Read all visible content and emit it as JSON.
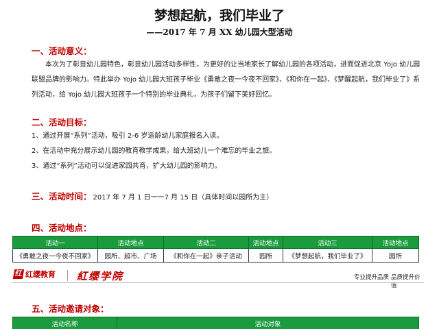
{
  "doc": {
    "title": "梦想起航，我们毕业了",
    "subtitle": "——2017 年 7 月 XX 幼儿园大型活动"
  },
  "sections": {
    "s1": {
      "heading": "一、活动意义：",
      "paragraph": "本次为了彰显幼儿园特色，彰显幼儿园活动多样性，为更好的让当地家长了解幼儿园的各项活动，进而促进北京 Yojo 幼儿园联盟品牌的影响力。特此举办 Yojo 幼儿园大班孩子毕业《勇敢之夜一今夜不回家》、《和你在一起》、《梦醒起航，我们毕业了》系列活动，给 Yojo 幼儿园大班孩子一个特别的毕业典礼，为孩子们留下美好回忆。"
    },
    "s2": {
      "heading": "二、活动目标：",
      "items": [
        "1、通过开展“系列”活动，吸引 2-6 岁适龄幼儿家庭报名入读。",
        "2、在活动中充分展示幼儿园的教育教学成果，给大班幼儿一个难忘的毕业之旅。",
        "3、通过“系列”活动可以促进家园共育，扩大幼儿园的影响力。"
      ]
    },
    "s3": {
      "heading": "三、活动时间：",
      "text": "2017 年 7 月 1 日一一7 月 15 日（具体时间以园所为主）"
    },
    "s4": {
      "heading": "四、活动地点：",
      "headers": [
        "活动一",
        "活动地点",
        "活动二",
        "活动地点",
        "活动三",
        "活动地点"
      ],
      "row": [
        "《勇敢之夜一今夜不回家》",
        "园所、超市、广场",
        "《和你在一起》亲子活动",
        "园所",
        "《梦想起航，我们毕业了》",
        "园所"
      ]
    },
    "s5": {
      "heading": "五、活动邀请对象：",
      "headers": [
        "活动名称",
        "活动对象"
      ]
    }
  },
  "banner": {
    "logo_mark": "红",
    "logo_a": "红缨教育",
    "logo_b": "紅缨学院",
    "slogan1": "专业提升品质",
    "slogan2": "品质提升价值"
  },
  "colors": {
    "heading": "#c00000",
    "table_header": "#1a9b3d"
  }
}
